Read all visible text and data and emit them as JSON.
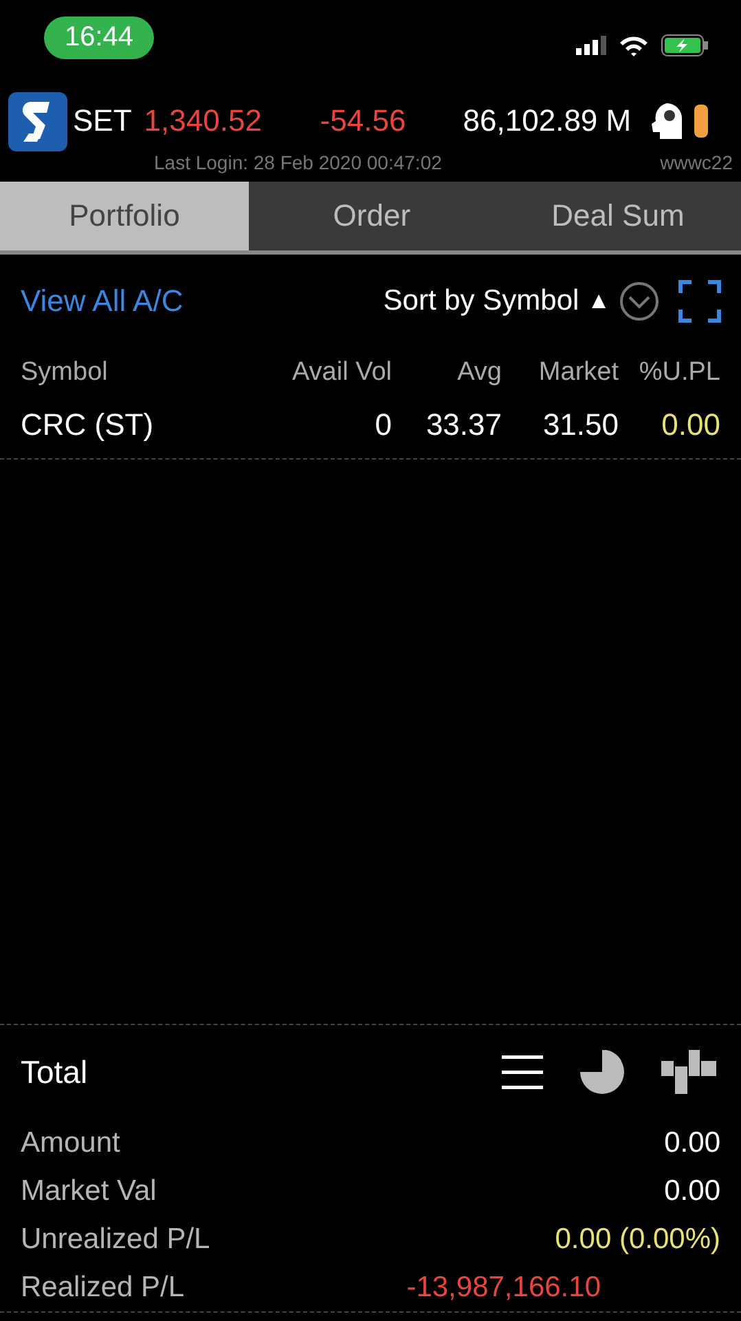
{
  "status_bar": {
    "time": "16:44"
  },
  "ticker": {
    "index": "SET",
    "value": "1,340.52",
    "change": "-54.56",
    "volume": "86,102.89 M",
    "last_login": "Last Login: 28 Feb 2020 00:47:02",
    "user": "wwwc22"
  },
  "tabs": [
    {
      "label": "Portfolio",
      "selected": true
    },
    {
      "label": "Order",
      "selected": false
    },
    {
      "label": "Deal Sum",
      "selected": false
    }
  ],
  "toolbar": {
    "view_all": "View All A/C",
    "sort": "Sort by Symbol",
    "sort_arrow": "▲"
  },
  "table": {
    "columns": [
      "Symbol",
      "Avail Vol",
      "Avg",
      "Market",
      "%U.PL"
    ],
    "rows": [
      {
        "cells": [
          "CRC (ST)",
          "0",
          "33.37",
          "31.50",
          "0.00"
        ]
      }
    ]
  },
  "total": {
    "title": "Total",
    "rows": [
      {
        "label": "Amount",
        "value": "0.00",
        "color": "#ffffff"
      },
      {
        "label": "Market Val",
        "value": "0.00",
        "color": "#ffffff"
      },
      {
        "label": "Unrealized P/L",
        "value": "0.00 (0.00%)",
        "color": "#e8e276"
      },
      {
        "label": "Realized P/L",
        "value": "-13,987,166.10",
        "color": "#e8453c"
      }
    ]
  }
}
